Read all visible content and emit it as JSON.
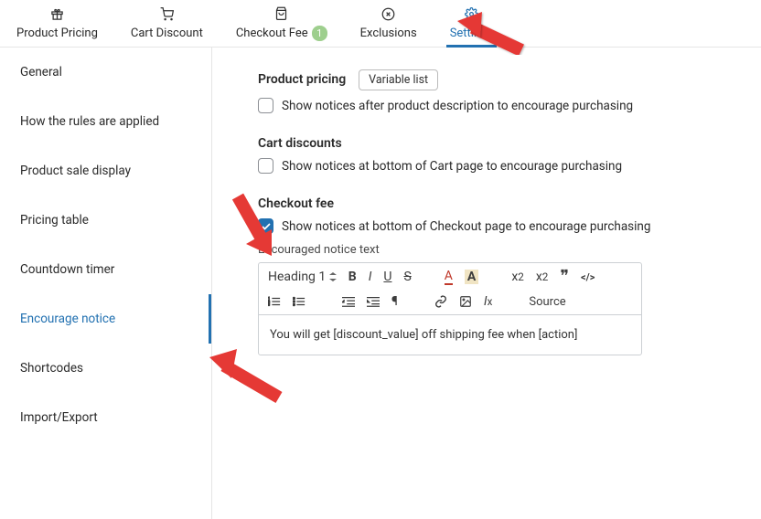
{
  "tabs": {
    "product_pricing": "Product Pricing",
    "cart_discount": "Cart Discount",
    "checkout_fee": "Checkout Fee",
    "checkout_fee_badge": "1",
    "exclusions": "Exclusions",
    "settings": "Settings"
  },
  "sidebar": {
    "general": "General",
    "how_applied": "How the rules are applied",
    "sale_display": "Product sale display",
    "pricing_table": "Pricing table",
    "countdown": "Countdown timer",
    "encourage": "Encourage notice",
    "shortcodes": "Shortcodes",
    "import_export": "Import/Export"
  },
  "content": {
    "product_pricing_label": "Product pricing",
    "variable_list_label": "Variable list",
    "product_notice": "Show notices after product description to encourage purchasing",
    "cart_discounts_label": "Cart discounts",
    "cart_notice": "Show notices at bottom of Cart page to encourage purchasing",
    "checkout_fee_label": "Checkout fee",
    "checkout_notice": "Show notices at bottom of Checkout page to encourage purchasing",
    "encourage_text_label": "Encouraged notice text",
    "heading_sel": "Heading 1",
    "source_label": "Source",
    "editor_content": "You will get [discount_value] off shipping fee when [action]"
  }
}
